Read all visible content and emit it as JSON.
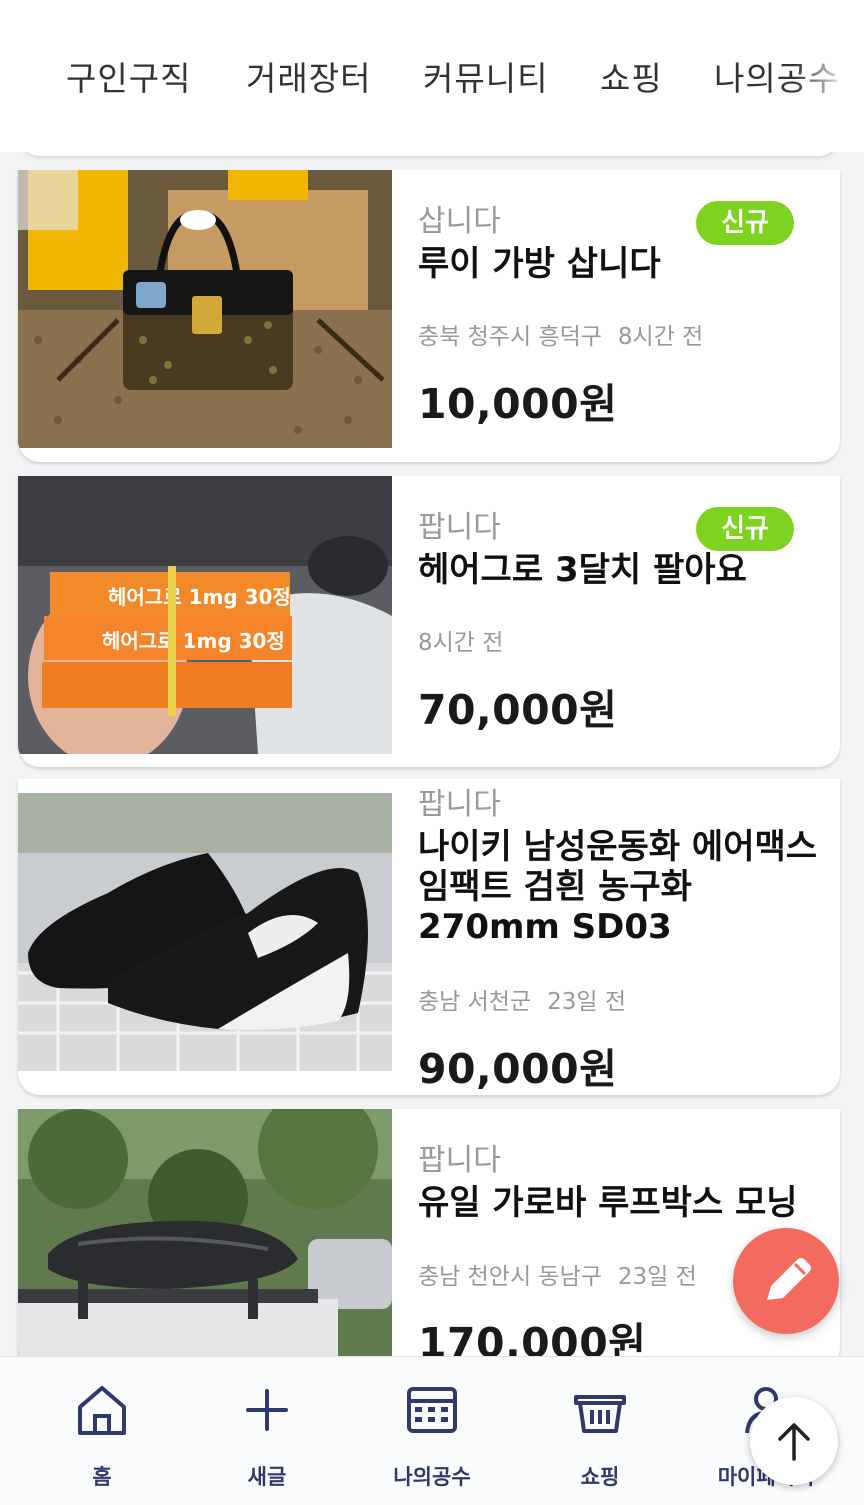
{
  "top_tabs": [
    "구인구직",
    "거래장터",
    "커뮤니티",
    "쇼핑",
    "나의공수"
  ],
  "listings": [
    {
      "category": "삽니다",
      "title": "루이 가방 삽니다",
      "location": "충북 청주시 흥덕구",
      "time": "8시간 전",
      "price": "10,000원",
      "badge": "신규",
      "image": "louis-vuitton-handbag"
    },
    {
      "category": "팝니다",
      "title": "헤어그로 3달치 팔아요",
      "location": "",
      "time": "8시간 전",
      "price": "70,000원",
      "badge": "신규",
      "image": "hairgro-medicine-boxes"
    },
    {
      "category": "팝니다",
      "title": "나이키 남성운동화 에어맥스 임팩트 검흰 농구화 270mm SD03",
      "location": "충남 서천군",
      "time": "23일 전",
      "price": "90,000원",
      "badge": "",
      "image": "nike-basketball-shoes"
    },
    {
      "category": "팝니다",
      "title": "유일 가로바 루프박스 모닝",
      "location": "충남 천안시 동남구",
      "time": "23일 전",
      "price": "170,000원",
      "badge": "",
      "image": "car-roof-box"
    }
  ],
  "bottom_nav": [
    {
      "label": "홈",
      "icon": "home-icon"
    },
    {
      "label": "새글",
      "icon": "plus-icon"
    },
    {
      "label": "나의공수",
      "icon": "calculator-icon"
    },
    {
      "label": "쇼핑",
      "icon": "basket-icon"
    },
    {
      "label": "마이페이지",
      "icon": "user-icon"
    }
  ],
  "colors": {
    "badge_green": "#7ed321",
    "fab_coral": "#f26b5e",
    "nav_navy": "#2f3a6b"
  }
}
